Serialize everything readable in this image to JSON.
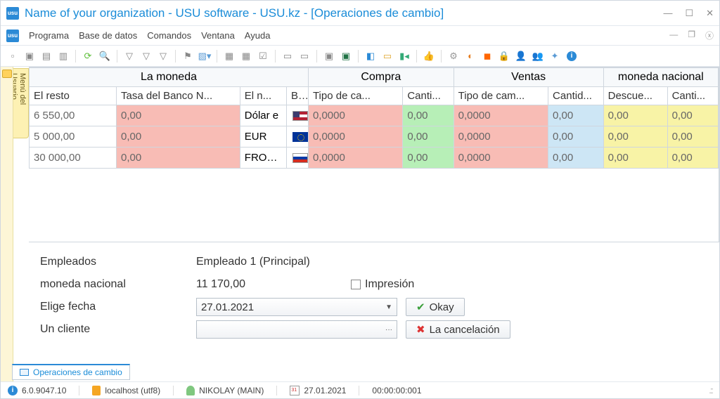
{
  "window": {
    "title": "Name of your organization - USU software - USU.kz - [Operaciones de cambio]"
  },
  "menu": [
    "Programa",
    "Base de datos",
    "Comandos",
    "Ventana",
    "Ayuda"
  ],
  "sidebar_tab": "Menú del Usuario",
  "grid": {
    "groups": [
      {
        "label": "La moneda",
        "span": 4
      },
      {
        "label": "Compra",
        "span": 2
      },
      {
        "label": "Ventas",
        "span": 2
      },
      {
        "label": "moneda nacional",
        "span": 2
      }
    ],
    "columns": [
      "El resto",
      "Tasa del Banco N...",
      "El n...",
      "B...",
      "Tipo de ca...",
      "Canti...",
      "Tipo de cam...",
      "Cantid...",
      "Descue...",
      "Canti..."
    ],
    "rows": [
      {
        "resto": "6 550,00",
        "tasa": "0,00",
        "nombre": "Dólar e",
        "flag": "us",
        "tipo1": "0,0000",
        "cant1": "0,00",
        "tipo2": "0,0000",
        "cant2": "0,00",
        "desc": "0,00",
        "cant3": "0,00"
      },
      {
        "resto": "5 000,00",
        "tasa": "0,00",
        "nombre": "EUR",
        "flag": "eu",
        "tipo1": "0,0000",
        "cant1": "0,00",
        "tipo2": "0,0000",
        "cant2": "0,00",
        "desc": "0,00",
        "cant3": "0,00"
      },
      {
        "resto": "30 000,00",
        "tasa": "0,00",
        "nombre": "FROTAI",
        "flag": "ru",
        "tipo1": "0,0000",
        "cant1": "0,00",
        "tipo2": "0,0000",
        "cant2": "0,00",
        "desc": "0,00",
        "cant3": "0,00"
      }
    ]
  },
  "form": {
    "empleados_label": "Empleados",
    "empleados_value": "Empleado 1 (Principal)",
    "nacional_label": "moneda nacional",
    "nacional_value": "11 170,00",
    "fecha_label": "Elige fecha",
    "fecha_value": "27.01.2021",
    "cliente_label": "Un cliente",
    "cliente_value": "",
    "impresion_label": "Impresión",
    "okay_label": "Okay",
    "cancel_label": "La cancelación"
  },
  "doc_tab": "Operaciones de cambio",
  "status": {
    "version": "6.0.9047.10",
    "host": "localhost (utf8)",
    "user": "NIKOLAY (MAIN)",
    "date": "27.01.2021",
    "timer": "00:00:00:001"
  }
}
